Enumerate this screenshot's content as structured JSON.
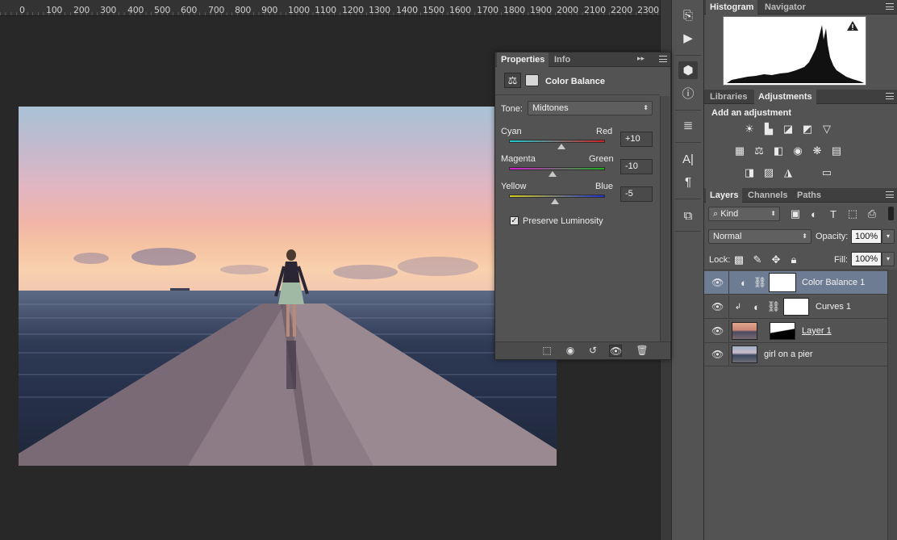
{
  "ruler": {
    "ticks": [
      "0",
      "100",
      "200",
      "300",
      "400",
      "500",
      "600",
      "700",
      "800",
      "900",
      "1000",
      "1100",
      "1200",
      "1300",
      "1400",
      "1500",
      "1600",
      "1700",
      "1800",
      "1900",
      "2000",
      "2100",
      "2200",
      "2300"
    ]
  },
  "histogram_panel": {
    "tabs": [
      "Histogram",
      "Navigator"
    ],
    "warning_icon": "warning-triangle-icon"
  },
  "adjustments_panel": {
    "tabs": [
      "Libraries",
      "Adjustments"
    ],
    "title": "Add an adjustment",
    "row1": [
      "brightness-contrast-icon",
      "levels-icon",
      "curves-icon",
      "exposure-icon",
      "gradient-triangle-icon"
    ],
    "row2": [
      "vibrance-icon",
      "color-balance-icon",
      "black-white-icon",
      "photo-filter-icon",
      "channel-mixer-icon",
      "color-lookup-icon"
    ],
    "row3": [
      "invert-icon",
      "posterize-icon",
      "threshold-icon",
      "gradient-map-icon"
    ]
  },
  "layers_panel": {
    "tabs": [
      "Layers",
      "Channels",
      "Paths"
    ],
    "filter": "Kind",
    "blend_mode": "Normal",
    "opacity_label": "Opacity:",
    "opacity_value": "100%",
    "lock_label": "Lock:",
    "fill_label": "Fill:",
    "fill_value": "100%",
    "layers": [
      {
        "name": "Color Balance 1",
        "selected": true
      },
      {
        "name": "Curves 1",
        "selected": false
      },
      {
        "name": "Layer 1",
        "selected": false
      },
      {
        "name": "girl on a pier",
        "selected": false
      }
    ]
  },
  "properties_panel": {
    "tabs": [
      "Properties",
      "Info"
    ],
    "adjustment_title": "Color Balance",
    "tone_label": "Tone:",
    "tone_value": "Midtones",
    "sliders": [
      {
        "left": "Cyan",
        "right": "Red",
        "value": "+10",
        "level": 10
      },
      {
        "left": "Magenta",
        "right": "Green",
        "value": "-10",
        "level": -10
      },
      {
        "left": "Yellow",
        "right": "Blue",
        "value": "-5",
        "level": -5
      }
    ],
    "preserve_luminosity": "Preserve Luminosity",
    "preserve_checked": true
  },
  "colors": {
    "panel_bg": "#535353",
    "selected_layer": "#6d7c93",
    "canvas_bg": "#282828"
  }
}
